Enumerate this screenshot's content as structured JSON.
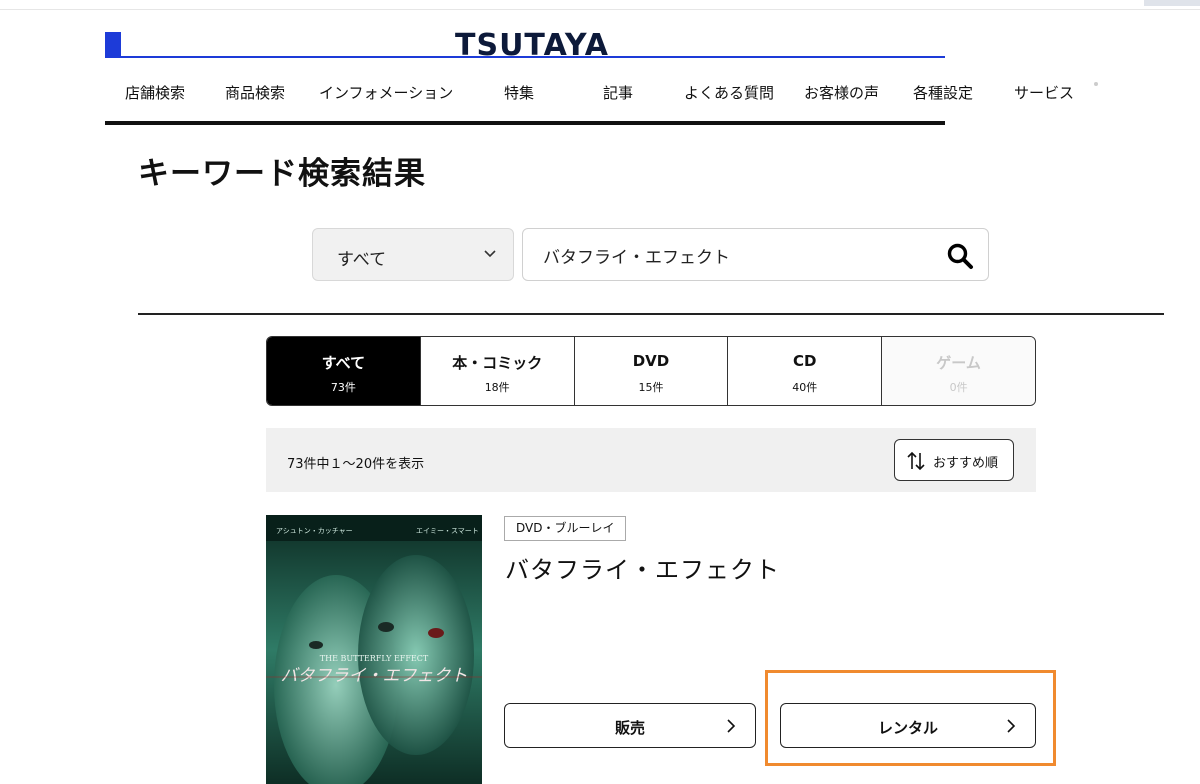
{
  "header": {
    "logo": "TSUTAYA",
    "brand_color": "#1d3bd8"
  },
  "nav": {
    "items": [
      "店舗検索",
      "商品検索",
      "インフォメーション",
      "特集",
      "記事",
      "よくある質問",
      "お客様の声",
      "各種設定",
      "サービス"
    ]
  },
  "page": {
    "title": "キーワード検索結果"
  },
  "search": {
    "category": "すべて",
    "query": "バタフライ・エフェクト",
    "chevron_icon": "chevron-down-icon",
    "search_icon": "search-icon"
  },
  "tabs": [
    {
      "label": "すべて",
      "count": "73件",
      "state": "active"
    },
    {
      "label": "本・コミック",
      "count": "18件",
      "state": "normal"
    },
    {
      "label": "DVD",
      "count": "15件",
      "state": "normal"
    },
    {
      "label": "CD",
      "count": "40件",
      "state": "normal"
    },
    {
      "label": "ゲーム",
      "count": "0件",
      "state": "disabled"
    }
  ],
  "results": {
    "summary": "73件中１～20件を表示",
    "sort_label": "おすすめ順",
    "sort_icon": "sort-icon"
  },
  "item": {
    "badge": "DVD・ブルーレイ",
    "title": "バタフライ・エフェクト",
    "cover": {
      "top_left": "アシュトン・カッチャー",
      "top_right": "エイミー・スマート",
      "en_title": "THE BUTTERFLY EFFECT",
      "jp_title": "バタフライ・エフェクト"
    },
    "sell_label": "販売",
    "rent_label": "レンタル"
  },
  "colors": {
    "highlight": "#f08a2f",
    "active_tab": "#000000",
    "result_bar": "#f0f0f0"
  }
}
